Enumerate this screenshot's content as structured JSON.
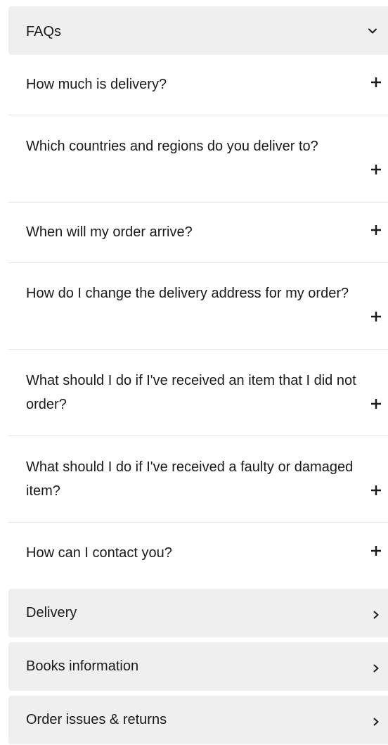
{
  "faq_section": {
    "title": "FAQs",
    "expanded": true,
    "icon": "chevron-down-icon",
    "questions": [
      {
        "text": "How much is delivery?",
        "icon": "plus-icon"
      },
      {
        "text": "Which countries and regions do you deliver to?",
        "icon": "plus-icon"
      },
      {
        "text": "When will my order arrive?",
        "icon": "plus-icon"
      },
      {
        "text": "How do I change the delivery address for my order?",
        "icon": "plus-icon"
      },
      {
        "text": "What should I do if I've received an item that I did not order?",
        "icon": "plus-icon"
      },
      {
        "text": "What should I do if I've received a faulty or damaged item?",
        "icon": "plus-icon"
      },
      {
        "text": "How can I contact you?",
        "icon": "plus-icon"
      }
    ]
  },
  "nav_sections": [
    {
      "label": "Delivery",
      "icon": "chevron-right-icon"
    },
    {
      "label": "Books information",
      "icon": "chevron-right-icon"
    },
    {
      "label": "Order issues & returns",
      "icon": "chevron-right-icon"
    }
  ],
  "colors": {
    "header_bg": "#efefef",
    "text": "#1a1a1a",
    "divider": "#e6e6e6"
  }
}
